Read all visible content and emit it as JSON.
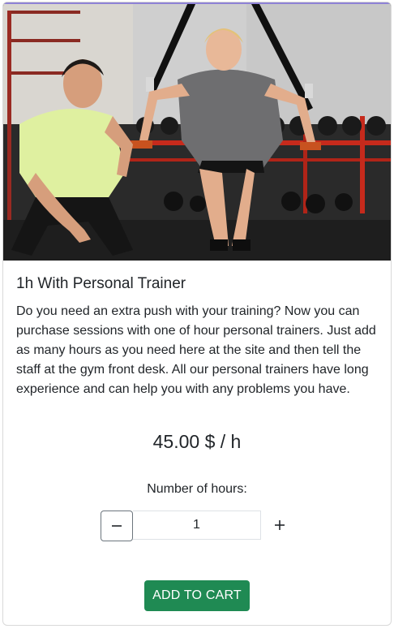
{
  "product": {
    "title": "1h With Personal Trainer",
    "description": "Do you need an extra push with your training? Now you can purchase sessions with one of hour personal trainers. Just add as many hours as you need here at the site and then tell the staff at the gym front desk. All our personal trainers have long experience and can help you with any problems you have.",
    "price": "45.00 $ / h",
    "image_icon": "personal-trainer-photo"
  },
  "quantity": {
    "label": "Number of hours:",
    "value": "1",
    "minus_icon": "minus-icon",
    "plus_icon": "plus-icon"
  },
  "actions": {
    "add_to_cart_label": "ADD TO CART"
  },
  "colors": {
    "accent_top": "#8e82d6",
    "cart_button": "#1f8a53",
    "border": "#d9d9d9"
  }
}
